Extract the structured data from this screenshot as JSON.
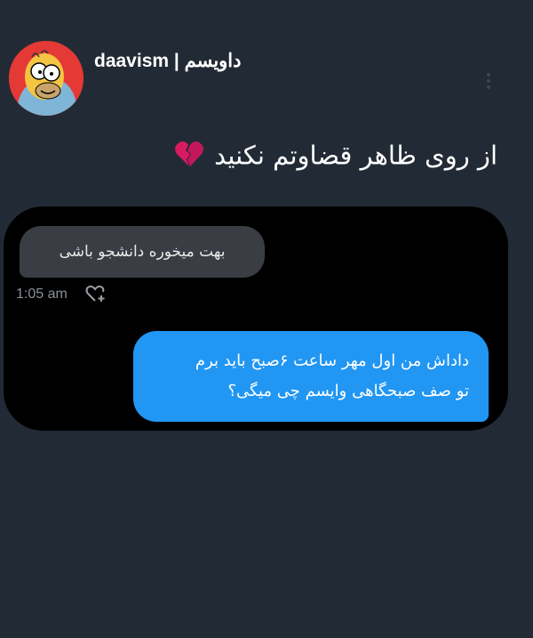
{
  "profile": {
    "username": "daavism | داویسم",
    "avatar_icon": "homer-avatar-icon",
    "avatar_bg": "#e53935"
  },
  "post": {
    "text": "از روی ظاهر قضاوتم نکنید",
    "emoji_icon": "broken-heart-icon"
  },
  "chat": {
    "received_message": "بهت میخوره دانشجو باشی",
    "received_time": "1:05 am",
    "sent_message_line1": "داداش من اول مهر ساعت ۶صبح باید برم",
    "sent_message_line2": "تو صف صبحگاهی وایسم چی میگی؟",
    "sent_color": "#2196f3",
    "received_color": "#3a3d43"
  }
}
